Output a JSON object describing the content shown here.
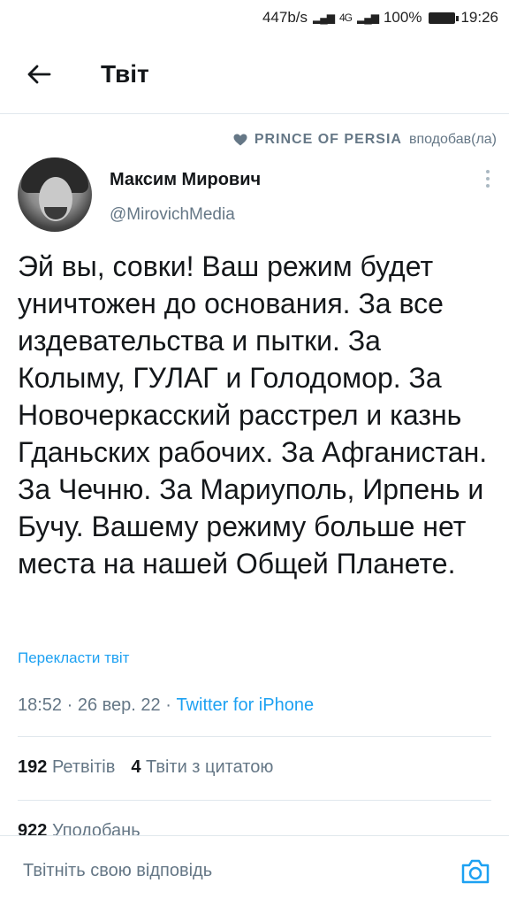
{
  "status_bar": {
    "speed": "447b/s",
    "network": "4G",
    "battery": "100%",
    "time": "19:26"
  },
  "header": {
    "title": "Твіт"
  },
  "liked_by": {
    "name": "PRINCE OF PERSIA",
    "suffix": "вподобав(ла)"
  },
  "tweet": {
    "author_name": "Максим Мирович",
    "author_handle": "@MirovichMedia",
    "text": "Эй вы, совки! Ваш режим будет уничтожен до основания. За все издевательства и пытки. За Колыму, ГУЛАГ и Голодомор. За Новочеркасский расстрел и казнь Гданьских рабочих. За Афганистан. За Чечню. За Мариуполь, Ирпень и Бучу. Вашему режиму больше нет места на нашей Общей Планете.",
    "translate": "Перекласти твіт",
    "time": "18:52",
    "date": "26 вер. 22",
    "source": "Twitter for iPhone"
  },
  "stats": {
    "retweets_count": "192",
    "retweets_label": "Ретвітів",
    "quotes_count": "4",
    "quotes_label": "Твіти з цитатою",
    "likes_count": "922",
    "likes_label": "Уподобань"
  },
  "reply": {
    "placeholder": "Твітніть свою відповідь"
  },
  "colors": {
    "accent": "#1da1f2",
    "secondary_text": "#657786",
    "divider": "#e1e8ed"
  }
}
